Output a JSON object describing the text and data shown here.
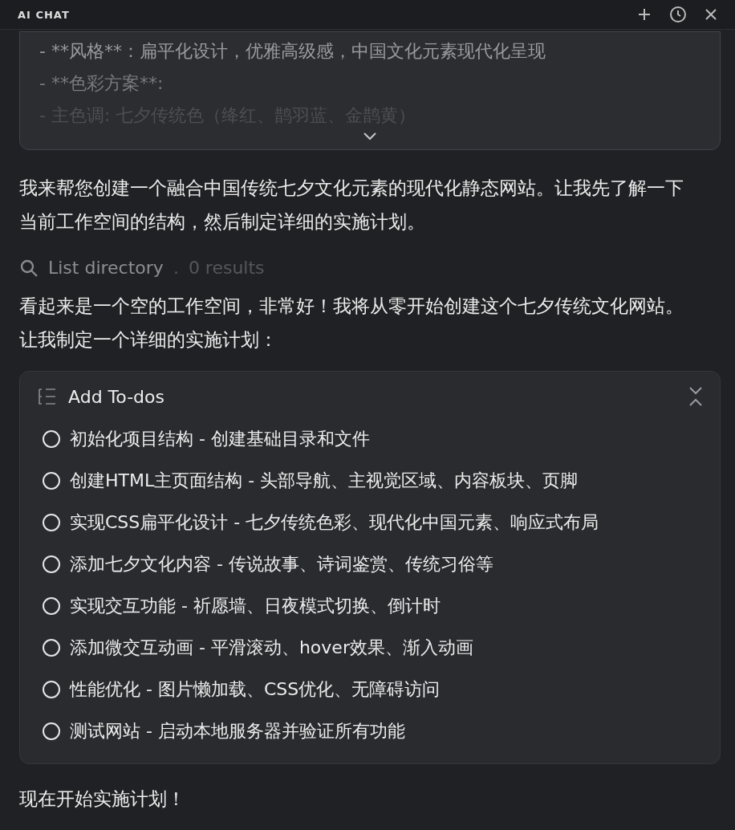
{
  "header": {
    "title": "AI CHAT"
  },
  "code_block": {
    "lines": [
      "- **风格**：扁平化设计，优雅高级感，中国文化元素现代化呈现",
      "- **色彩方案**:",
      "- 主色调: 七夕传统色（绛红、鹊羽蓝、金鹊黄）"
    ],
    "expanded": false
  },
  "messages": [
    {
      "kind": "text",
      "text": "我来帮您创建一个融合中国传统七夕文化元素的现代化静态网站。让我先了解一下当前工作空间的结构，然后制定详细的实施计划。"
    },
    {
      "kind": "tool",
      "label": "List directory",
      "separator": ".",
      "result": "0 results"
    },
    {
      "kind": "text",
      "text": "看起来是一个空的工作空间，非常好！我将从零开始创建这个七夕传统文化网站。让我制定一个详细的实施计划："
    },
    {
      "kind": "todos",
      "title": "Add To-dos",
      "items": [
        {
          "text": "初始化项目结构 - 创建基础目录和文件",
          "checked": false
        },
        {
          "text": "创建HTML主页面结构 - 头部导航、主视觉区域、内容板块、页脚",
          "checked": false
        },
        {
          "text": "实现CSS扁平化设计 - 七夕传统色彩、现代化中国元素、响应式布局",
          "checked": false
        },
        {
          "text": "添加七夕文化内容 - 传说故事、诗词鉴赏、传统习俗等",
          "checked": false
        },
        {
          "text": "实现交互功能 - 祈愿墙、日夜模式切换、倒计时",
          "checked": false
        },
        {
          "text": "添加微交互动画 - 平滑滚动、hover效果、渐入动画",
          "checked": false
        },
        {
          "text": "性能优化 - 图片懒加载、CSS优化、无障碍访问",
          "checked": false
        },
        {
          "text": "测试网站 - 启动本地服务器并验证所有功能",
          "checked": false
        }
      ]
    },
    {
      "kind": "text",
      "text": "现在开始实施计划！"
    }
  ]
}
